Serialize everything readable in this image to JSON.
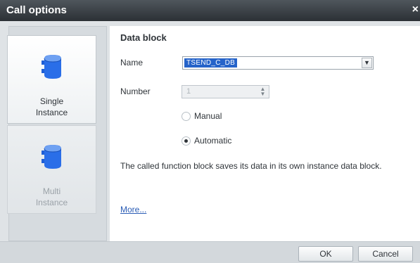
{
  "window": {
    "title": "Call options",
    "close_glyph": "×"
  },
  "instance_options": [
    {
      "label_line1": "Single",
      "label_line2": "Instance",
      "selected": true,
      "icon": "database-icon"
    },
    {
      "label_line1": "Multi",
      "label_line2": "Instance",
      "selected": false,
      "enabled": false,
      "icon": "database-icon"
    }
  ],
  "data_block": {
    "section_title": "Data block",
    "name_label": "Name",
    "name_value": "TSEND_C_DB",
    "number_label": "Number",
    "number_value": "1",
    "radio_manual": "Manual",
    "radio_automatic": "Automatic",
    "selected_mode": "Automatic",
    "description": "The called function block saves its data in its own instance data block.",
    "more_link": "More..."
  },
  "buttons": {
    "ok": "OK",
    "cancel": "Cancel"
  },
  "colors": {
    "titlebar": "#2b3035",
    "selection": "#2563c9",
    "icon_blue": "#1f5fd6",
    "link": "#2a5cb5"
  }
}
